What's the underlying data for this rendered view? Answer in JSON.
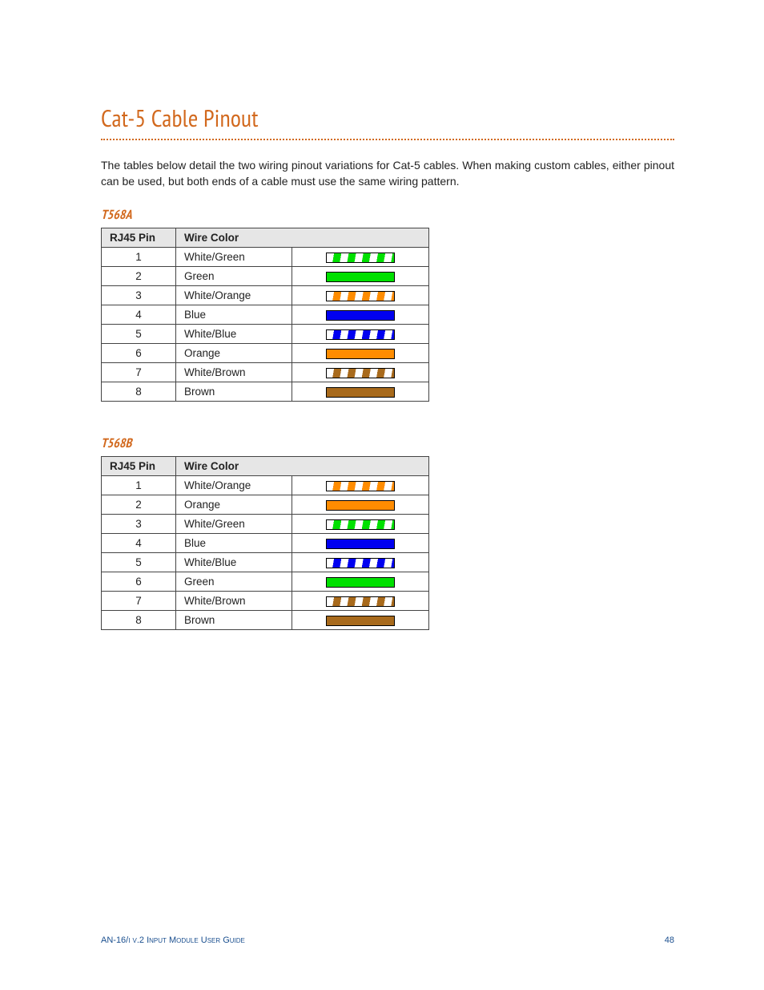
{
  "title": "Cat-5 Cable Pinout",
  "intro": "The tables below detail the two wiring pinout variations for Cat-5 cables. When making custom cables, either pinout can be used, but both ends of a cable must use the same wiring pattern.",
  "columns": {
    "pin": "RJ45 Pin",
    "color": "Wire Color"
  },
  "t568a": {
    "heading": "T568A",
    "rows": [
      {
        "pin": "1",
        "color": "White/Green",
        "swatch": "stripe-green"
      },
      {
        "pin": "2",
        "color": "Green",
        "swatch": "solid-green"
      },
      {
        "pin": "3",
        "color": "White/Orange",
        "swatch": "stripe-orange"
      },
      {
        "pin": "4",
        "color": "Blue",
        "swatch": "solid-blue"
      },
      {
        "pin": "5",
        "color": "White/Blue",
        "swatch": "stripe-blue"
      },
      {
        "pin": "6",
        "color": "Orange",
        "swatch": "solid-orange"
      },
      {
        "pin": "7",
        "color": "White/Brown",
        "swatch": "stripe-brown"
      },
      {
        "pin": "8",
        "color": "Brown",
        "swatch": "solid-brown"
      }
    ]
  },
  "t568b": {
    "heading": "T568B",
    "rows": [
      {
        "pin": "1",
        "color": "White/Orange",
        "swatch": "stripe-orange"
      },
      {
        "pin": "2",
        "color": "Orange",
        "swatch": "solid-orange"
      },
      {
        "pin": "3",
        "color": "White/Green",
        "swatch": "stripe-green"
      },
      {
        "pin": "4",
        "color": "Blue",
        "swatch": "solid-blue"
      },
      {
        "pin": "5",
        "color": "White/Blue",
        "swatch": "stripe-blue"
      },
      {
        "pin": "6",
        "color": "Green",
        "swatch": "solid-green"
      },
      {
        "pin": "7",
        "color": "White/Brown",
        "swatch": "stripe-brown"
      },
      {
        "pin": "8",
        "color": "Brown",
        "swatch": "solid-brown"
      }
    ]
  },
  "footer": {
    "left": "AN-16/i v.2 Input Module User Guide",
    "page": "48"
  }
}
